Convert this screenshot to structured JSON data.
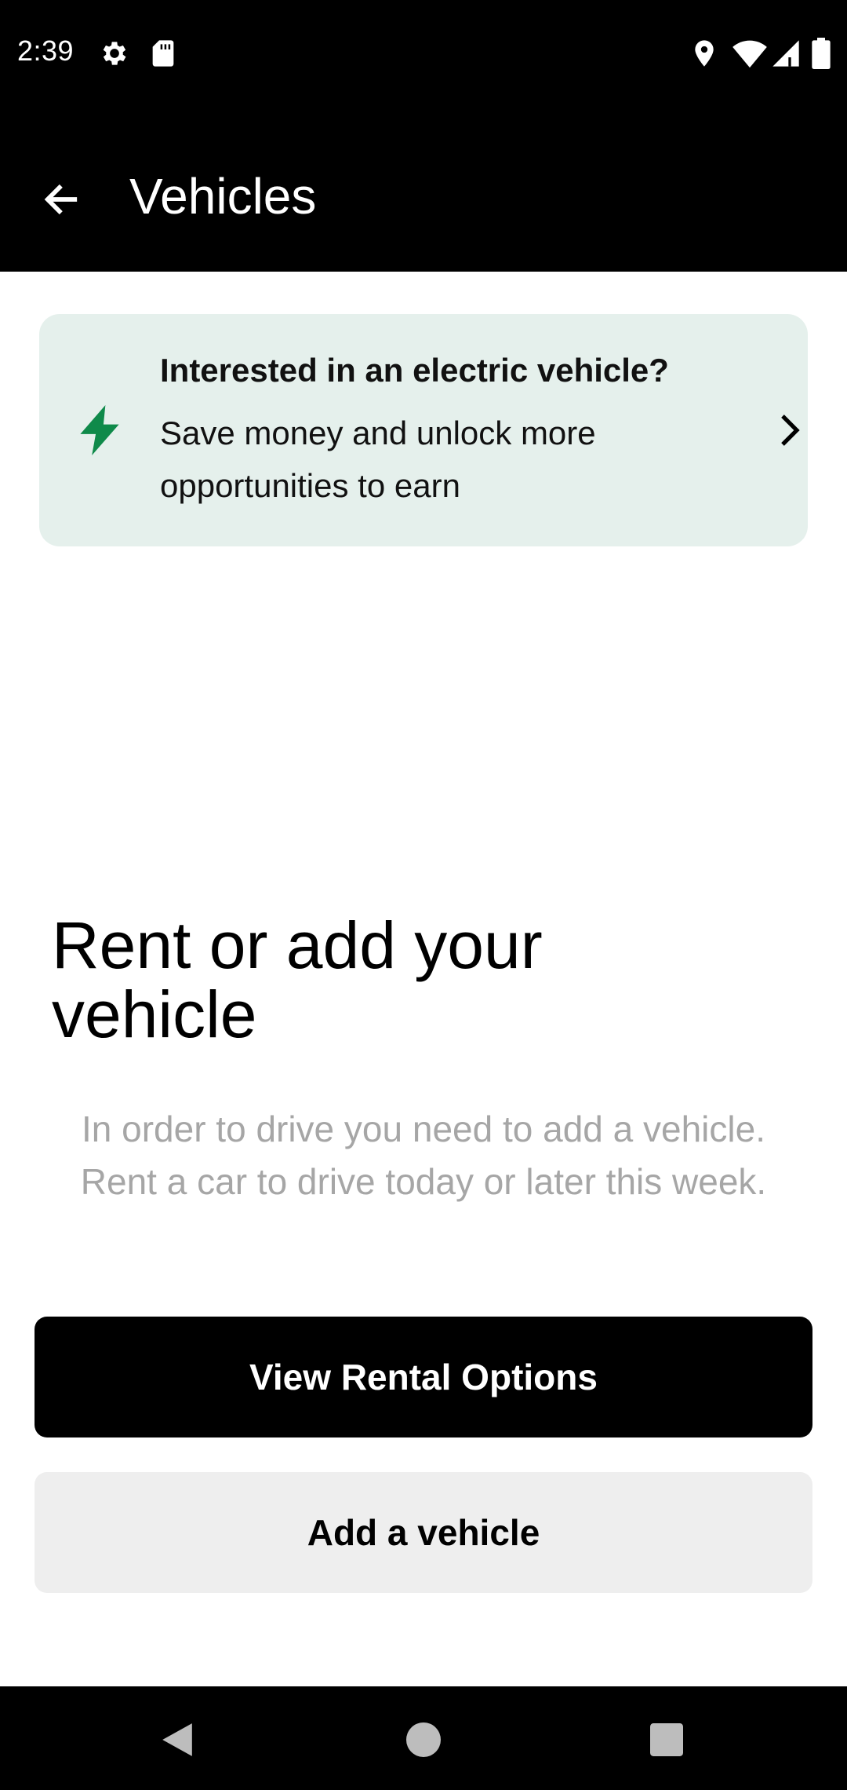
{
  "status_bar": {
    "time": "2:39",
    "left_icons": [
      "gear-icon",
      "sd-card-icon"
    ],
    "right_icons": [
      "location-icon",
      "wifi-icon",
      "signal-icon",
      "battery-icon"
    ]
  },
  "app_bar": {
    "title": "Vehicles",
    "back_icon": "arrow-left-icon"
  },
  "ev_card": {
    "icon": "lightning-bolt-icon",
    "title": "Interested in an electric vehicle?",
    "body": "Save money and unlock more opportunities to earn",
    "chevron_icon": "chevron-right-icon",
    "accent_color": "#0f8a4a",
    "background_color": "#e5f0ec"
  },
  "rent_section": {
    "heading": "Rent or add your vehicle",
    "description": "In order to drive you need to add a vehicle. Rent a car to drive today or later this week."
  },
  "buttons": {
    "primary_label": "View Rental Options",
    "secondary_label": "Add a vehicle"
  },
  "nav_bar": {
    "back_icon": "nav-back-triangle-icon",
    "home_icon": "nav-home-circle-icon",
    "recents_icon": "nav-recents-square-icon"
  }
}
